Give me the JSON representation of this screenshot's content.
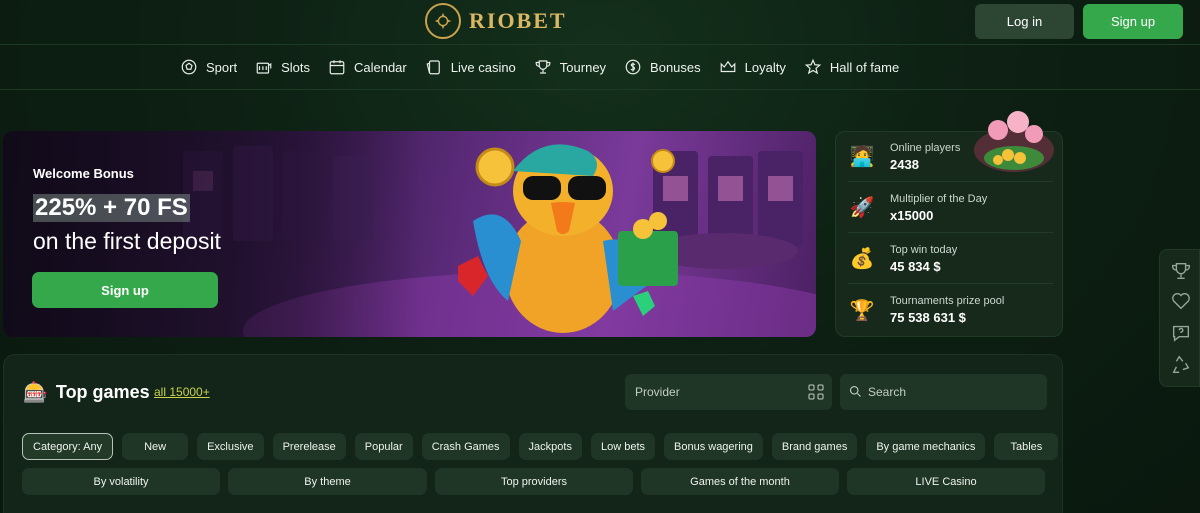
{
  "brand": {
    "name": "RIOBET",
    "gold": "#d9b763",
    "accent": "#34a84a"
  },
  "header": {
    "login_label": "Log in",
    "signup_label": "Sign up"
  },
  "nav": {
    "items": [
      {
        "label": "Sport",
        "icon": "ball-icon"
      },
      {
        "label": "Slots",
        "icon": "slots-icon"
      },
      {
        "label": "Calendar",
        "icon": "calendar-icon"
      },
      {
        "label": "Live casino",
        "icon": "cards-icon"
      },
      {
        "label": "Tourney",
        "icon": "trophy-icon"
      },
      {
        "label": "Bonuses",
        "icon": "coin-icon"
      },
      {
        "label": "Loyalty",
        "icon": "crown-icon"
      },
      {
        "label": "Hall of fame",
        "icon": "star-icon"
      }
    ]
  },
  "hero": {
    "subtitle": "Welcome Bonus",
    "headline": "225% + 70 FS",
    "line": "on the first deposit",
    "button_label": "Sign up"
  },
  "stats": [
    {
      "label": "Online players",
      "value": "2438",
      "icon": "player-icon"
    },
    {
      "label": "Multiplier of the Day",
      "value": "x15000",
      "icon": "rocket-icon"
    },
    {
      "label": "Top win today",
      "value": "45 834 $",
      "icon": "money-bag-icon"
    },
    {
      "label": "Tournaments prize pool",
      "value": "75 538 631 $",
      "icon": "trophy-icon"
    }
  ],
  "top_games": {
    "title": "Top games",
    "all_link": "all 15000+",
    "provider_placeholder": "Provider",
    "search_placeholder": "Search",
    "categories": [
      "Category: Any",
      "New",
      "Exclusive",
      "Prerelease",
      "Popular",
      "Crash Games",
      "Jackpots",
      "Low bets",
      "Bonus wagering",
      "Brand games",
      "By game mechanics",
      "Tables"
    ],
    "filters": [
      "By volatility",
      "By theme",
      "Top providers",
      "Games of the month",
      "LIVE Casino"
    ]
  }
}
